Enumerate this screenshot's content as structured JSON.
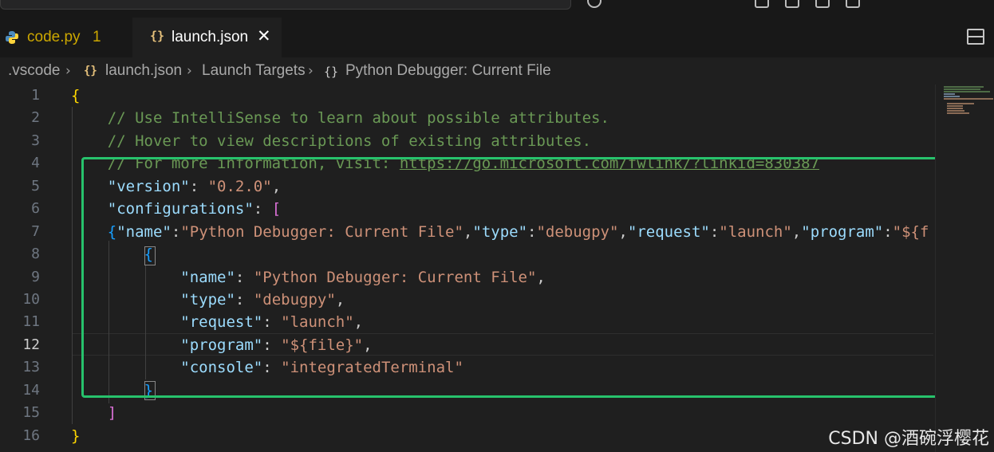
{
  "tabs": [
    {
      "label": "code.py",
      "badge": "1",
      "icon": "python-icon"
    },
    {
      "label": "launch.json",
      "icon": "json-braces-icon",
      "close": "✕"
    }
  ],
  "breadcrumb": {
    "folder": ".vscode",
    "file": "launch.json",
    "section": "Launch Targets",
    "item": "Python Debugger: Current File",
    "braces": "{}",
    "obj_braces": "{}"
  },
  "editor": {
    "line_numbers": [
      "1",
      "2",
      "3",
      "4",
      "5",
      "6",
      "7",
      "8",
      "9",
      "10",
      "11",
      "12",
      "13",
      "14",
      "15",
      "16"
    ],
    "active_line": "12",
    "l1": "{",
    "l2": "// Use IntelliSense to learn about possible attributes.",
    "l3": "// Hover to view descriptions of existing attributes.",
    "l4_comment": "// For more information, visit: ",
    "l4_url": "https://go.microsoft.com/fwlink/?linkid=830387",
    "version_key": "\"version\"",
    "version_val": "\"0.2.0\"",
    "configurations_key": "\"configurations\"",
    "l7_name_key": "\"name\"",
    "l7_name_val": "\"Python Debugger: Current File\"",
    "l7_type_key": "\"type\"",
    "l7_type_val": "\"debugpy\"",
    "l7_request_key": "\"request\"",
    "l7_request_val": "\"launch\"",
    "l7_program_key": "\"program\"",
    "l7_program_val": "\"${f",
    "name_key": "\"name\"",
    "name_val": "\"Python Debugger: Current File\"",
    "type_key": "\"type\"",
    "type_val": "\"debugpy\"",
    "request_key": "\"request\"",
    "request_val": "\"launch\"",
    "program_key": "\"program\"",
    "program_val": "\"${file}\"",
    "console_key": "\"console\"",
    "console_val": "\"integratedTerminal\""
  },
  "watermark": "CSDN @酒碗浮樱花",
  "colors": {
    "highlight_box": "#27c26c",
    "comment": "#6a9955",
    "key": "#9cdcfe",
    "string": "#ce9178"
  }
}
